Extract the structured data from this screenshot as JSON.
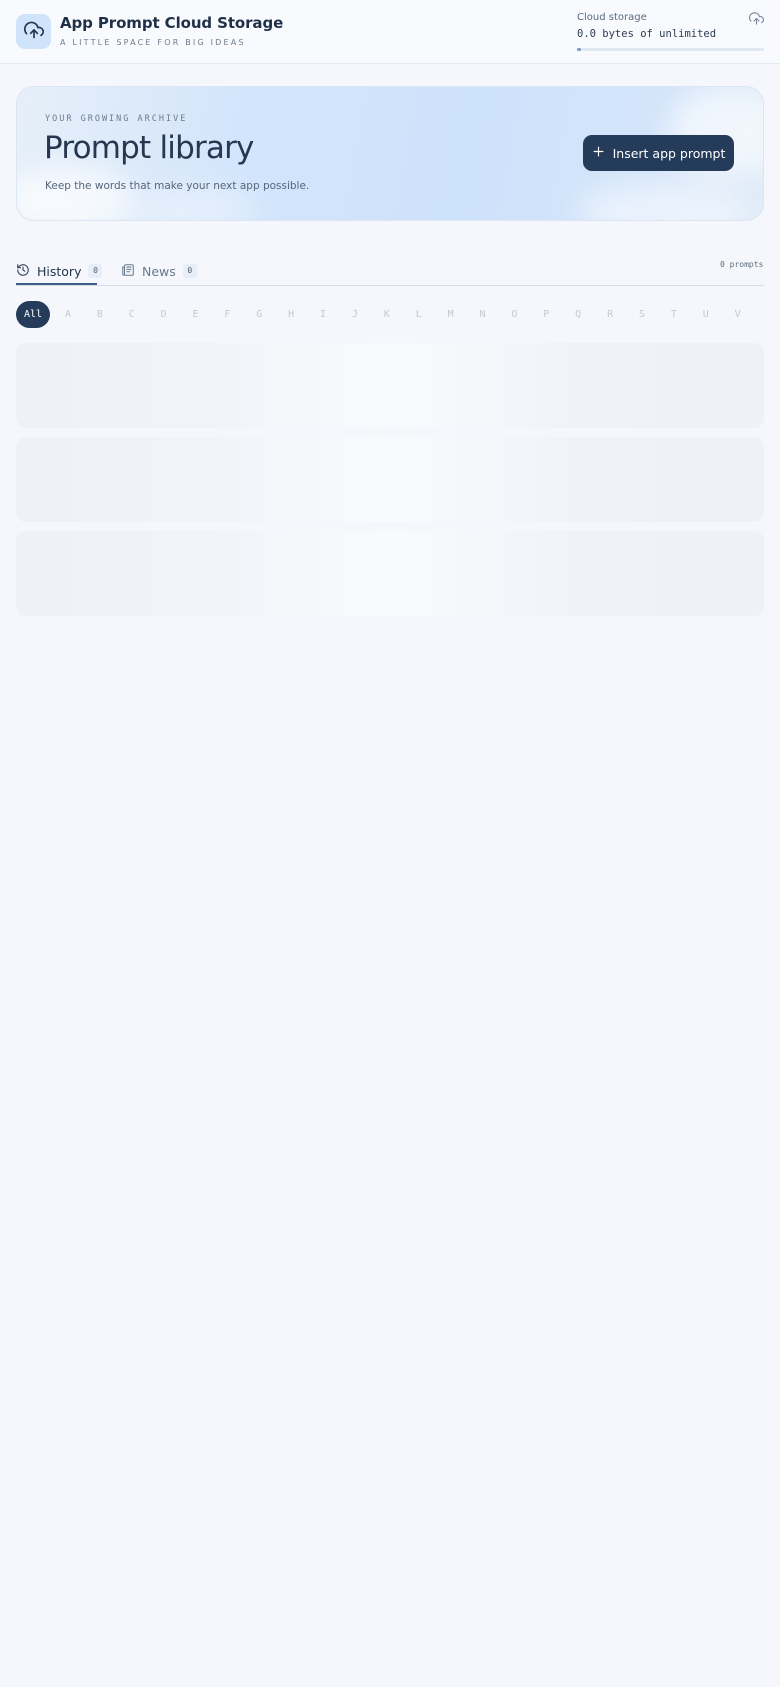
{
  "header": {
    "app_title": "App Prompt Cloud Storage",
    "tagline": "A LITTLE SPACE FOR BIG IDEAS",
    "logo_icon": "cloud-upload-icon",
    "storage": {
      "label": "Cloud storage",
      "value": "0.0 bytes of unlimited",
      "used_fraction": 0.0,
      "icon": "cloud-upload-icon"
    }
  },
  "hero": {
    "eyebrow": "YOUR GROWING ARCHIVE",
    "title": "Prompt library",
    "subtitle": "Keep the words that make your next app possible.",
    "insert_button_label": "Insert app prompt"
  },
  "tabs": [
    {
      "label": "History",
      "count": "0",
      "icon": "history-icon",
      "active": true
    },
    {
      "label": "News",
      "count": "0",
      "icon": "newspaper-icon",
      "active": false
    }
  ],
  "prompt_total": "0 prompts",
  "letter_filter": {
    "all_label": "All",
    "letters": [
      "A",
      "B",
      "C",
      "D",
      "E",
      "F",
      "G",
      "H",
      "I",
      "J",
      "K",
      "L",
      "M",
      "N",
      "O",
      "P",
      "Q",
      "R",
      "S",
      "T",
      "U",
      "V"
    ]
  },
  "colors": {
    "page_background": "#f5f7fc",
    "primary": "#243b5a",
    "accent_light": "#cfe3fb",
    "muted_letter": "#c2cad6"
  }
}
